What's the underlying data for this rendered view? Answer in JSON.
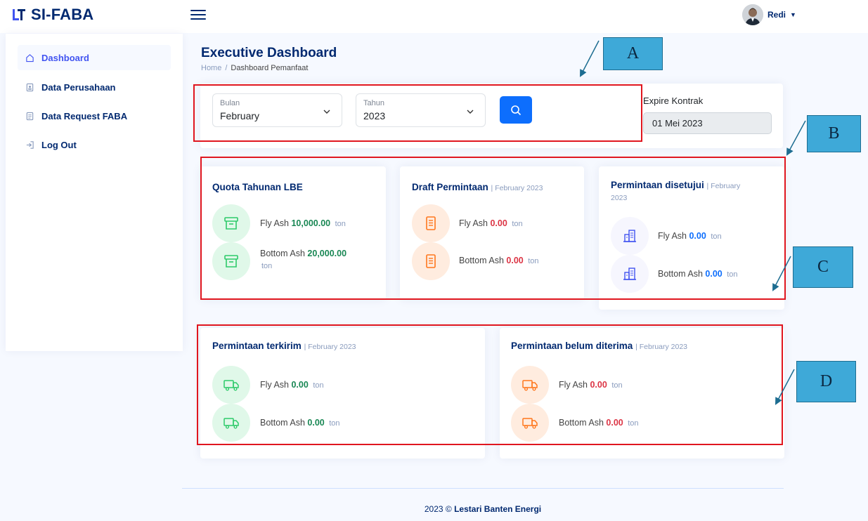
{
  "app": {
    "logo_text": "SI-FABA"
  },
  "user": {
    "name": "Redi"
  },
  "sidebar": {
    "items": [
      {
        "label": "Dashboard",
        "icon": "home-icon"
      },
      {
        "label": "Data Perusahaan",
        "icon": "id-card-icon"
      },
      {
        "label": "Data Request FABA",
        "icon": "document-icon"
      },
      {
        "label": "Log Out",
        "icon": "logout-icon"
      }
    ]
  },
  "page": {
    "title": "Executive Dashboard",
    "breadcrumb": {
      "home": "Home",
      "separator": "/",
      "current": "Dashboard Pemanfaat"
    }
  },
  "filter": {
    "month_label": "Bulan",
    "month_value": "February",
    "year_label": "Tahun",
    "year_value": "2023"
  },
  "expire": {
    "label": "Expire Kontrak",
    "value": "01 Mei 2023"
  },
  "cards": {
    "quota": {
      "title": "Quota Tahunan LBE",
      "fly_label": "Fly Ash",
      "fly_value": "10,000.00",
      "fly_unit": "ton",
      "bottom_label": "Bottom Ash",
      "bottom_value": "20,000.00",
      "bottom_unit": "ton"
    },
    "draft": {
      "title": "Draft Permintaan",
      "subtitle": "| February 2023",
      "fly_label": "Fly Ash",
      "fly_value": "0.00",
      "fly_unit": "ton",
      "bottom_label": "Bottom Ash",
      "bottom_value": "0.00",
      "bottom_unit": "ton"
    },
    "approved": {
      "title": "Permintaan disetujui",
      "subtitle": "| February",
      "subtitle2": "2023",
      "fly_label": "Fly Ash",
      "fly_value": "0.00",
      "fly_unit": "ton",
      "bottom_label": "Bottom Ash",
      "bottom_value": "0.00",
      "bottom_unit": "ton"
    },
    "sent": {
      "title": "Permintaan terkirim",
      "subtitle": "| February 2023",
      "fly_label": "Fly Ash",
      "fly_value": "0.00",
      "fly_unit": "ton",
      "bottom_label": "Bottom Ash",
      "bottom_value": "0.00",
      "bottom_unit": "ton"
    },
    "not_received": {
      "title": "Permintaan belum diterima",
      "subtitle": "| February 2023",
      "fly_label": "Fly Ash",
      "fly_value": "0.00",
      "fly_unit": "ton",
      "bottom_label": "Bottom Ash",
      "bottom_value": "0.00",
      "bottom_unit": "ton"
    }
  },
  "annotations": {
    "a": "A",
    "b": "B",
    "c": "C",
    "d": "D"
  },
  "footer": {
    "year": "2023 ©",
    "company": "Lestari Banten Energi"
  },
  "colors": {
    "navy": "#012970",
    "accent": "#4154f1",
    "green": "#198754",
    "red": "#dc3545",
    "blue": "#0d6efd",
    "annotation_box": "#e0161f",
    "callout": "#3ea9d8"
  }
}
